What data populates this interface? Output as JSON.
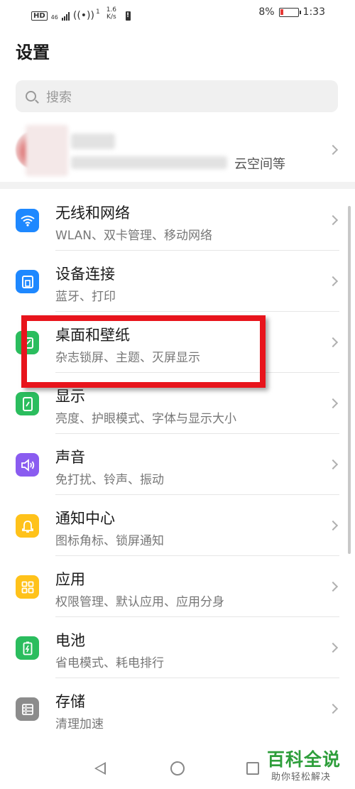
{
  "status_bar": {
    "hd": "HD",
    "net_type": "46",
    "hotspot_count": "1",
    "speed_value": "1.6",
    "speed_unit": "K/s",
    "battery": "8%",
    "time": "1:33",
    "battery_color": "#e53935"
  },
  "page_title": "设置",
  "search": {
    "placeholder": "搜索",
    "icon": "search-icon"
  },
  "account": {
    "subtitle": "云空间等"
  },
  "settings": [
    {
      "title": "无线和网络",
      "subtitle": "WLAN、双卡管理、移动网络",
      "icon": "wifi-icon",
      "color": "#1e88ff"
    },
    {
      "title": "设备连接",
      "subtitle": "蓝牙、打印",
      "icon": "device-connection-icon",
      "color": "#1e88ff"
    },
    {
      "title": "桌面和壁纸",
      "subtitle": "杂志锁屏、主题、灭屏显示",
      "icon": "wallpaper-icon",
      "color": "#2bbd5e"
    },
    {
      "title": "显示",
      "subtitle": "亮度、护眼模式、字体与显示大小",
      "icon": "display-icon",
      "color": "#2bbd5e"
    },
    {
      "title": "声音",
      "subtitle": "免打扰、铃声、振动",
      "icon": "sound-icon",
      "color": "#8a5cf0"
    },
    {
      "title": "通知中心",
      "subtitle": "图标角标、锁屏通知",
      "icon": "bell-icon",
      "color": "#ffc21a"
    },
    {
      "title": "应用",
      "subtitle": "权限管理、默认应用、应用分身",
      "icon": "apps-icon",
      "color": "#ffc21a"
    },
    {
      "title": "电池",
      "subtitle": "省电模式、耗电排行",
      "icon": "battery-icon",
      "color": "#2bbd5e"
    },
    {
      "title": "存储",
      "subtitle": "清理加速",
      "icon": "storage-icon",
      "color": "#8c8c8c"
    }
  ],
  "watermark": {
    "title": "百科全说",
    "subtitle": "助你轻松解决"
  }
}
